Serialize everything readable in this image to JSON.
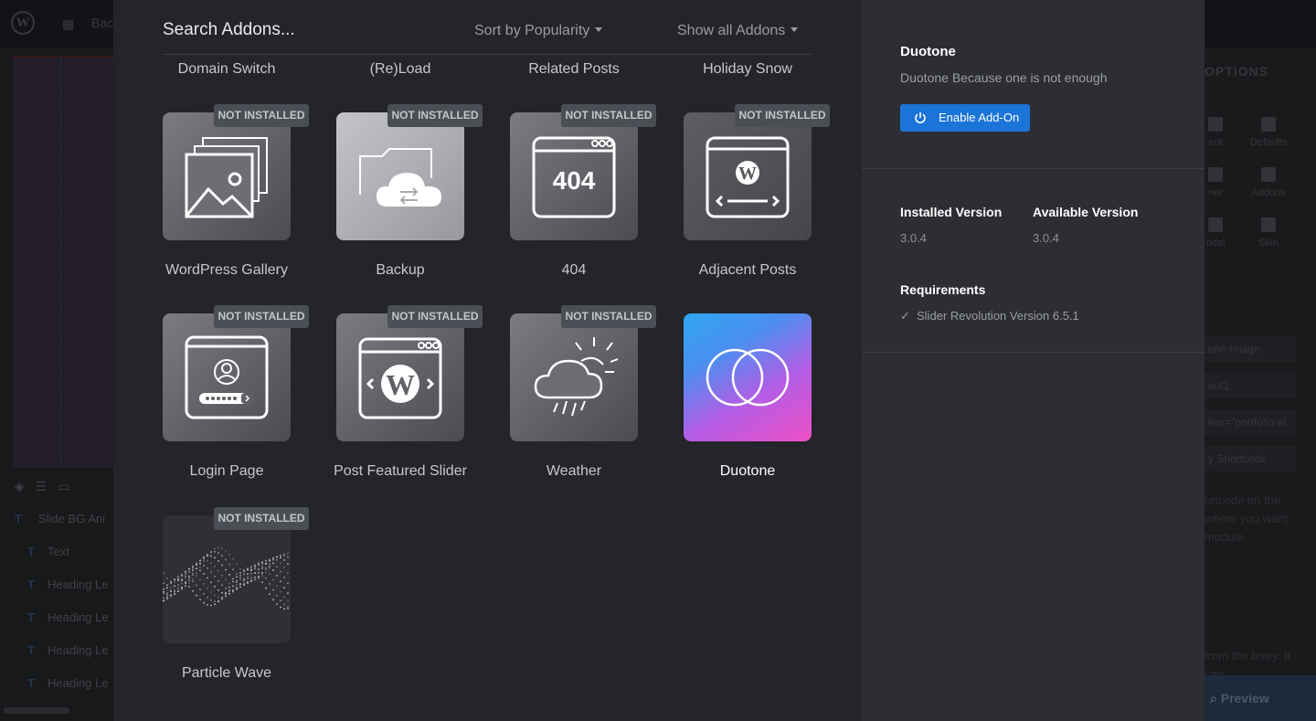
{
  "background": {
    "back_label": "Bac",
    "layers": [
      {
        "type": "T",
        "name": "Slide BG Ani"
      },
      {
        "type": "T",
        "name": "Text"
      },
      {
        "type": "T",
        "name": "Heading Le"
      },
      {
        "type": "T",
        "name": "Heading Le"
      },
      {
        "type": "T",
        "name": "Heading Le"
      },
      {
        "type": "T",
        "name": "Heading Le"
      }
    ],
    "options_title": "OPTIONS",
    "tabs": [
      "ent",
      "Defaults",
      "ner",
      "Addons",
      "odal",
      "Skin"
    ],
    "fields": [
      "one Image",
      "out1",
      "lias=\"portfolio-al",
      "y Shortcode"
    ],
    "help_text": "ortcode on the where you want module.",
    "help_text2": "from the brary. It can",
    "preview_label": "Preview"
  },
  "modal": {
    "search_placeholder": "Search Addons...",
    "sort_label": "Sort by Popularity",
    "filter_label": "Show all Addons",
    "top_row": [
      "Domain Switch",
      "(Re)Load",
      "Related Posts",
      "Holiday Snow"
    ],
    "badge_text": "NOT INSTALLED",
    "addons": [
      {
        "name": "WordPress Gallery",
        "icon": "gallery-icon",
        "installed": false,
        "selected": false
      },
      {
        "name": "Backup",
        "icon": "cloud-backup-icon",
        "installed": false,
        "selected": false
      },
      {
        "name": "404",
        "icon": "404-page-icon",
        "icon_text": "404",
        "installed": false,
        "selected": false
      },
      {
        "name": "Adjacent Posts",
        "icon": "adjacent-posts-icon",
        "installed": false,
        "selected": false
      },
      {
        "name": "Login Page",
        "icon": "login-page-icon",
        "installed": false,
        "selected": false
      },
      {
        "name": "Post Featured Slider",
        "icon": "wordpress-slider-icon",
        "installed": false,
        "selected": false
      },
      {
        "name": "Weather",
        "icon": "weather-icon",
        "installed": false,
        "selected": false
      },
      {
        "name": "Duotone",
        "icon": "duotone-circles-icon",
        "installed": true,
        "selected": true
      },
      {
        "name": "Particle Wave",
        "icon": "particle-wave-image",
        "installed": false,
        "selected": false
      }
    ]
  },
  "detail": {
    "title": "Duotone",
    "description": "Duotone Because one is not enough",
    "button_label": "Enable Add-On",
    "installed_version_label": "Installed Version",
    "installed_version": "3.0.4",
    "available_version_label": "Available Version",
    "available_version": "3.0.4",
    "requirements_label": "Requirements",
    "requirement": "Slider Revolution Version 6.5.1"
  },
  "colors": {
    "accent_button": "#1b74d8",
    "modal_bg": "#23252a",
    "panel_bg": "#2c2e33",
    "badge_bg": "#4b4e55"
  }
}
